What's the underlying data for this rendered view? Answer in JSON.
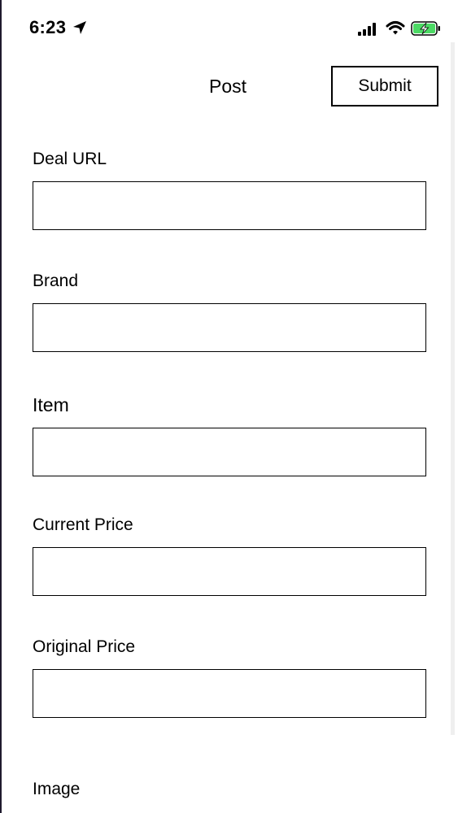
{
  "status_bar": {
    "time": "6:23",
    "icons": [
      "location-arrow-icon",
      "cellular-signal-icon",
      "wifi-icon",
      "battery-charging-icon"
    ],
    "battery_color": "#4cd964"
  },
  "nav": {
    "title": "Post",
    "submit_label": "Submit"
  },
  "form": {
    "deal_url": {
      "label": "Deal URL",
      "value": ""
    },
    "brand": {
      "label": "Brand",
      "value": ""
    },
    "item": {
      "label": "Item",
      "value": ""
    },
    "current_price": {
      "label": "Current Price",
      "value": ""
    },
    "original_price": {
      "label": "Original Price",
      "value": ""
    },
    "image": {
      "label": "Image"
    }
  }
}
